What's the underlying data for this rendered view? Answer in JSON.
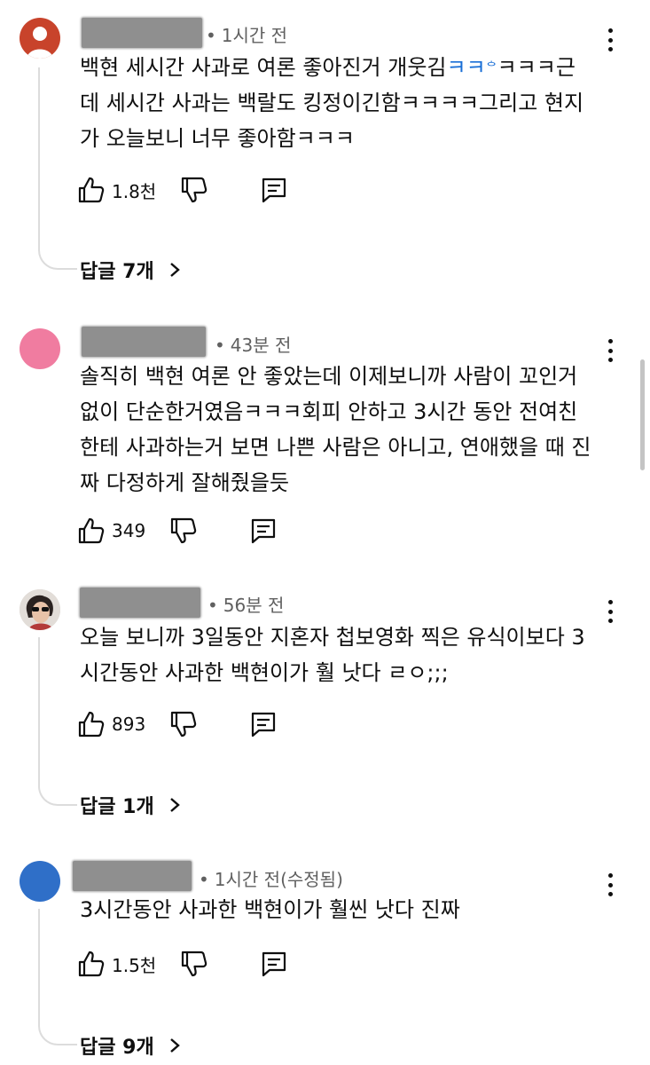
{
  "colors": {
    "avatar_1": "#c8432b",
    "avatar_2": "#f07ca0",
    "avatar_4": "#2f6fc8",
    "link_blue": "#1a6fd6",
    "meta_gray": "#606060"
  },
  "icons": {
    "like": "thumb-up-icon",
    "dislike": "thumb-down-icon",
    "reply": "comment-icon",
    "more": "more-vert-icon",
    "expand": "chevron-right-icon"
  },
  "comments": [
    {
      "time": "1시간 전",
      "lines": [
        "백현 세시간 사과로 여론 좋아진거 개웃김",
        "데 세시간 사과는 백랄도 킹정이긴함ㅋㅋㅋㅋ그리고 현지",
        "가 오늘보니 너무 좋아함ㅋㅋㅋ"
      ],
      "inline_blue": "ㅋㅋ",
      "inline_mark": "ᅌ",
      "inline_tail": "ㅋㅋㅋ근",
      "likes": "1.8천",
      "replies": "답글 7개"
    },
    {
      "time": "43분 전",
      "lines": [
        "솔직히 백현 여론 안 좋았는데 이제보니까 사람이 꼬인거",
        "없이 단순한거였음ㅋㅋㅋ회피 안하고 3시간 동안 전여친",
        "한테 사과하는거 보면 나쁜 사람은 아니고, 연애했을 때 진",
        "짜 다정하게 잘해줬을듯"
      ],
      "likes": "349"
    },
    {
      "time": "56분 전",
      "lines": [
        "오늘 보니까 3일동안 지혼자 첩보영화 찍은 유식이보다 3",
        "시간동안 사과한 백현이가 훨 낫다 ㄹㅇ;;;"
      ],
      "likes": "893",
      "replies": "답글 1개"
    },
    {
      "time": "1시간 전(수정됨)",
      "lines": [
        "3시간동안 사과한 백현이가 훨씬 낫다 진짜"
      ],
      "likes": "1.5천",
      "replies": "답글 9개"
    }
  ]
}
